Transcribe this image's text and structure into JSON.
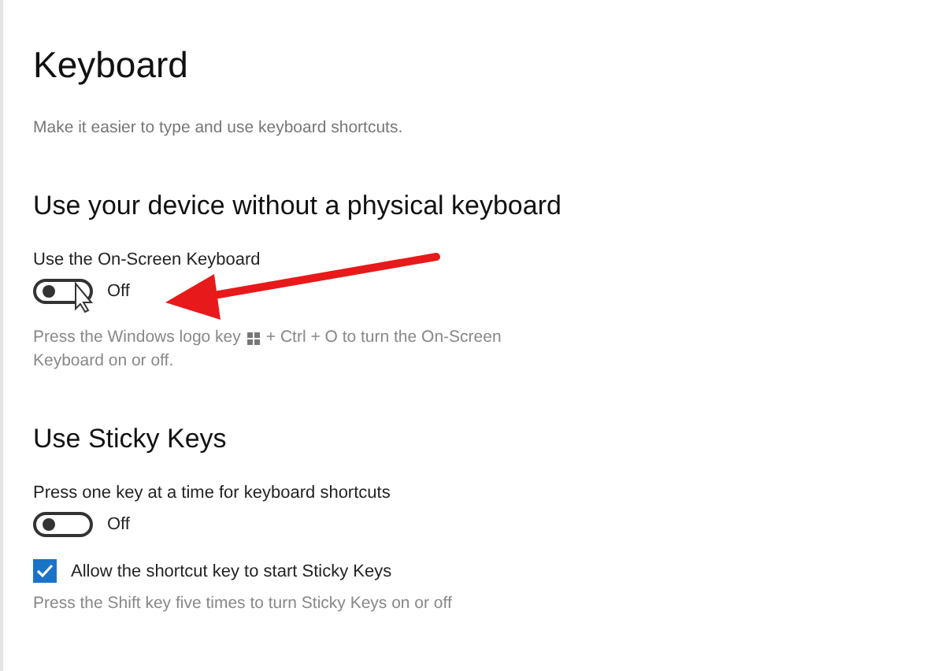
{
  "title": "Keyboard",
  "subtitle": "Make it easier to type and use keyboard shortcuts.",
  "sections": [
    {
      "heading": "Use your device without a physical keyboard",
      "items": [
        {
          "kind": "toggle",
          "label": "Use the On-Screen Keyboard",
          "on": false,
          "state_text": "Off"
        },
        {
          "kind": "hint",
          "before": "Press the Windows logo key",
          "after": "+ Ctrl + O to turn the On-Screen",
          "rest": "Keyboard on or off."
        }
      ]
    },
    {
      "heading": "Use Sticky Keys",
      "items": [
        {
          "kind": "toggle",
          "label": "Press one key at a time for keyboard shortcuts",
          "on": false,
          "state_text": "Off"
        },
        {
          "kind": "checkbox",
          "label": "Allow the shortcut key to start Sticky Keys",
          "checked": true
        },
        {
          "kind": "hint",
          "after": "Press the Shift key five times to turn Sticky Keys on or off"
        }
      ]
    }
  ]
}
